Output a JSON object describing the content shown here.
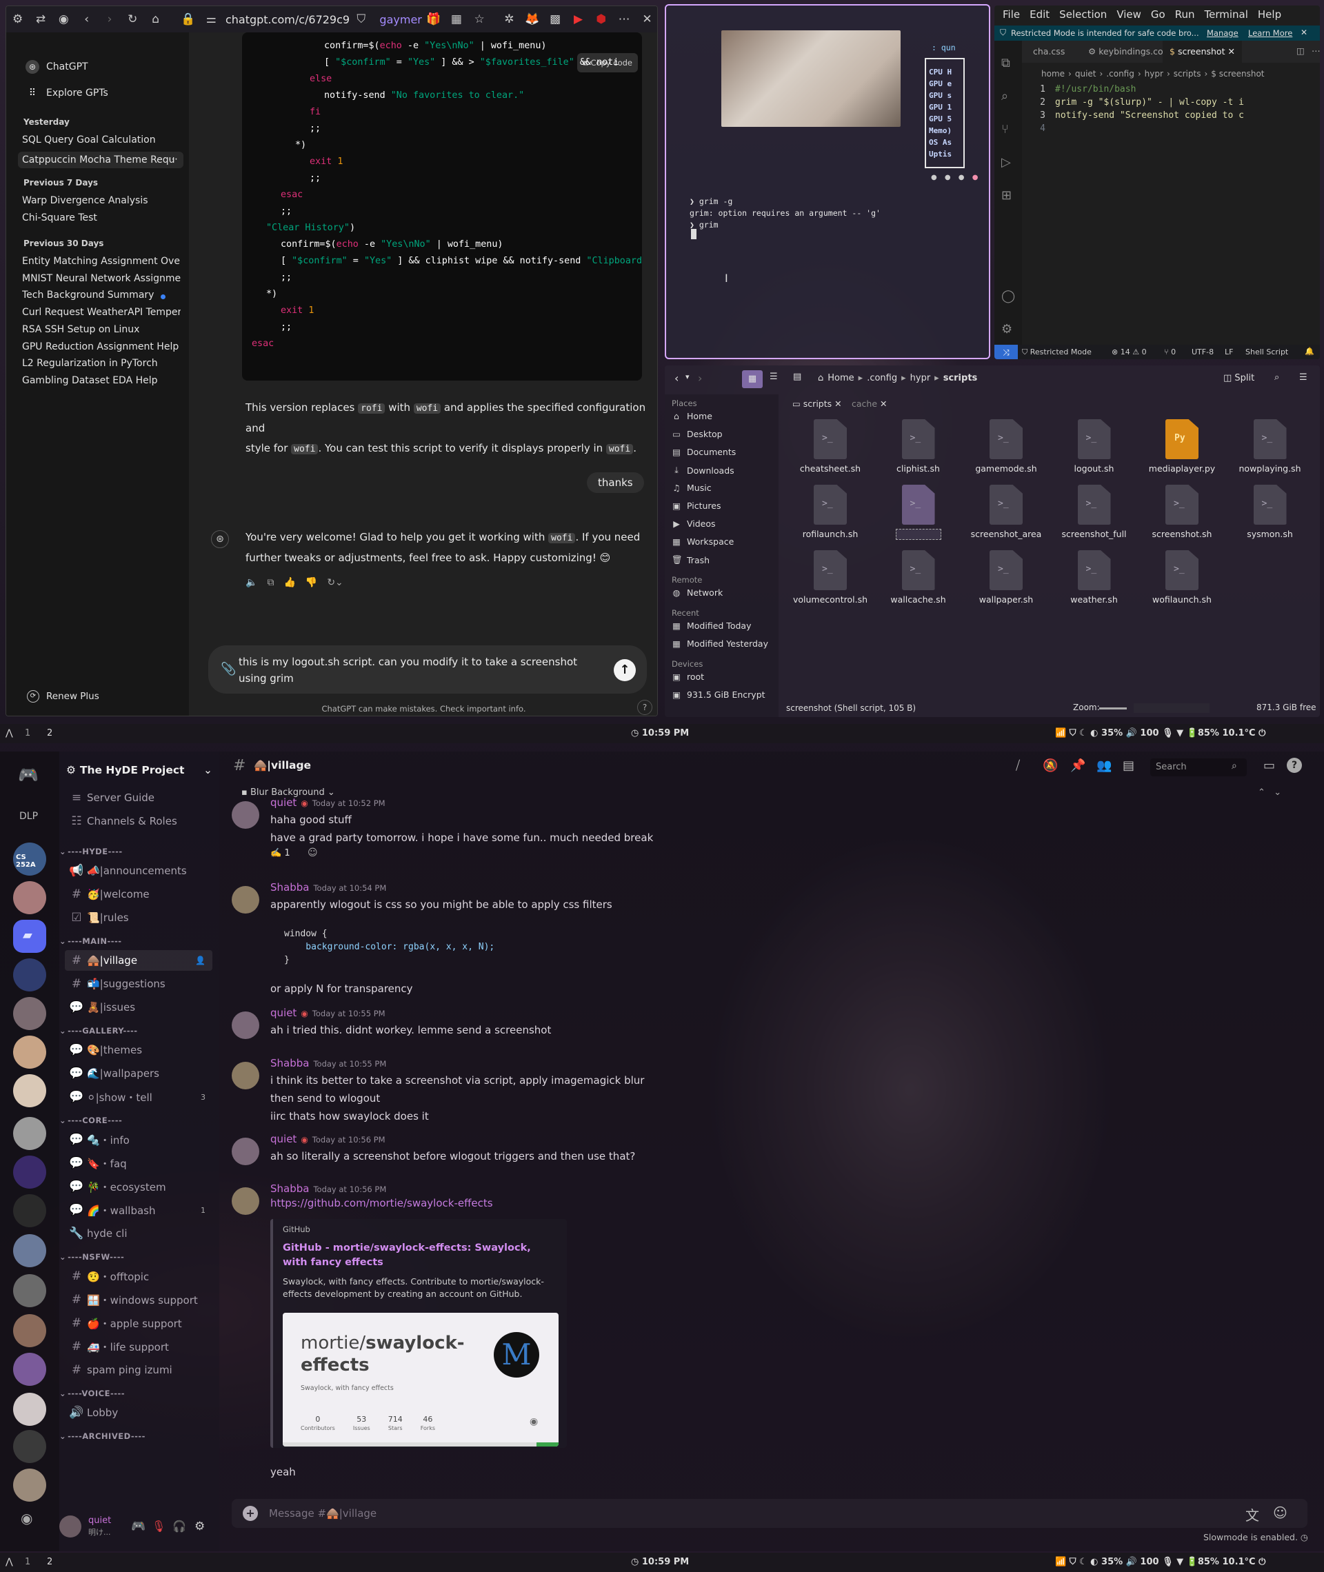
{
  "browser": {
    "url": "chatgpt.com/c/6729c9",
    "profile": "gaymer",
    "sidebar": {
      "top_items": [
        "ChatGPT",
        "Explore GPTs"
      ],
      "sections": [
        {
          "title": "Yesterday",
          "items": [
            "SQL Query Goal Calculation",
            "Catppuccin Mocha Theme Requ"
          ]
        },
        {
          "title": "Previous 7 Days",
          "items": [
            "Warp Divergence Analysis",
            "Chi-Square Test"
          ]
        },
        {
          "title": "Previous 30 Days",
          "items": [
            "Entity Matching Assignment Overv",
            "MNIST Neural Network Assignmen",
            "Tech Background Summary",
            "Curl Request WeatherAPI Tempera",
            "RSA SSH Setup on Linux",
            "GPU Reduction Assignment Help",
            "L2 Regularization in PyTorch",
            "Gambling Dataset EDA Help"
          ]
        }
      ],
      "renew": "Renew Plus"
    },
    "chat": {
      "copy_code": "Copy code",
      "code_lines": [
        {
          "indent": 10,
          "parts": [
            [
              "pl",
              "confirm=$("
            ],
            [
              "kw",
              "echo"
            ],
            [
              "pl",
              " -e "
            ],
            [
              "st",
              "\"Yes\\nNo\""
            ],
            [
              "pl",
              " | wofi_menu)"
            ]
          ]
        },
        {
          "indent": 10,
          "parts": [
            [
              "pl",
              "[ "
            ],
            [
              "st",
              "\"$confirm\""
            ],
            [
              "pl",
              " = "
            ],
            [
              "st",
              "\"Yes\""
            ],
            [
              "pl",
              " ] && > "
            ],
            [
              "st",
              "\"$favorites_file\""
            ],
            [
              "pl",
              " && noti"
            ]
          ]
        },
        {
          "indent": 8,
          "parts": [
            [
              "kw",
              "else"
            ]
          ]
        },
        {
          "indent": 10,
          "parts": [
            [
              "pl",
              "notify-send "
            ],
            [
              "st",
              "\"No favorites to clear.\""
            ]
          ]
        },
        {
          "indent": 8,
          "parts": [
            [
              "kw",
              "fi"
            ]
          ]
        },
        {
          "indent": 8,
          "parts": [
            [
              "pl",
              ";;"
            ]
          ]
        },
        {
          "indent": 6,
          "parts": [
            [
              "pl",
              "*)"
            ]
          ]
        },
        {
          "indent": 8,
          "parts": [
            [
              "kw",
              "exit"
            ],
            [
              "pl",
              " "
            ],
            [
              "vr",
              "1"
            ]
          ]
        },
        {
          "indent": 8,
          "parts": [
            [
              "pl",
              ";;"
            ]
          ]
        },
        {
          "indent": 4,
          "parts": [
            [
              "kw",
              "esac"
            ]
          ]
        },
        {
          "indent": 4,
          "parts": [
            [
              "pl",
              ";;"
            ]
          ]
        },
        {
          "indent": 2,
          "parts": [
            [
              "st",
              "\"Clear History\""
            ],
            [
              "pl",
              ")"
            ]
          ]
        },
        {
          "indent": 4,
          "parts": [
            [
              "pl",
              "confirm=$("
            ],
            [
              "kw",
              "echo"
            ],
            [
              "pl",
              " -e "
            ],
            [
              "st",
              "\"Yes\\nNo\""
            ],
            [
              "pl",
              " | wofi_menu)"
            ]
          ]
        },
        {
          "indent": 4,
          "parts": [
            [
              "pl",
              "[ "
            ],
            [
              "st",
              "\"$confirm\""
            ],
            [
              "pl",
              " = "
            ],
            [
              "st",
              "\"Yes\""
            ],
            [
              "pl",
              " ] && cliphist wipe && notify-send "
            ],
            [
              "st",
              "\"Clipboard"
            ]
          ]
        },
        {
          "indent": 4,
          "parts": [
            [
              "pl",
              ";;"
            ]
          ]
        },
        {
          "indent": 2,
          "parts": [
            [
              "pl",
              "*)"
            ]
          ]
        },
        {
          "indent": 4,
          "parts": [
            [
              "kw",
              "exit"
            ],
            [
              "pl",
              " "
            ],
            [
              "vr",
              "1"
            ]
          ]
        },
        {
          "indent": 4,
          "parts": [
            [
              "pl",
              ";;"
            ]
          ]
        },
        {
          "indent": 0,
          "parts": [
            [
              "kw",
              "esac"
            ]
          ]
        }
      ],
      "reply1_a": "This version replaces ",
      "reply1_rofi": "rofi",
      "reply1_b": " with ",
      "reply1_wofi": "wofi",
      "reply1_c": " and applies the specified configuration and",
      "reply1_d": "style for ",
      "reply1_e": ". You can test this script to verify it displays properly in ",
      "reply1_f": ".",
      "user_msg": "thanks",
      "reply2_a": "You're very welcome! Glad to help you get it working with ",
      "reply2_b": ". If you need",
      "reply2_c": "further tweaks or adjustments, feel free to ask. Happy customizing! 😊",
      "input_text": "this is my logout.sh script. can you modify it to take a screenshot using grim",
      "disclaimer": "ChatGPT can make mistakes. Check important info."
    }
  },
  "terminal": {
    "user": ": qun",
    "stats": [
      "CPU H",
      "GPU e",
      "GPU s",
      "GPU 1",
      "GPU 5",
      "Memo)",
      "OS As",
      "Uptis"
    ],
    "lines": [
      "❯ grim -g",
      "grim: option requires an argument -- 'g'",
      "❯ grim"
    ]
  },
  "vscode": {
    "menu": [
      "File",
      "Edit",
      "Selection",
      "View",
      "Go",
      "Run",
      "Terminal",
      "Help"
    ],
    "banner": "Restricted Mode is intended for safe code bro...",
    "banner_manage": "Manage",
    "banner_learn": "Learn More",
    "tabs": [
      "cha.css",
      "keybindings.conf",
      "screenshot"
    ],
    "breadcrumb": [
      "home",
      "quiet",
      ".config",
      "hypr",
      "scripts",
      "$ screenshot"
    ],
    "lines": [
      {
        "n": "1",
        "text": "#!/usr/bin/bash"
      },
      {
        "n": "2",
        "text": "grim -g \"$(slurp)\" - | wl-copy -t i"
      },
      {
        "n": "3",
        "text": "notify-send \"Screenshot copied to c"
      },
      {
        "n": "4",
        "text": ""
      }
    ],
    "status": {
      "mode": "Restricted Mode",
      "errors": "14",
      "warnings": "0",
      "ports": "0",
      "encoding": "UTF-8",
      "eol": "LF",
      "lang": "Shell Script"
    }
  },
  "files": {
    "path": [
      "Home",
      ".config",
      "hypr",
      "scripts"
    ],
    "split": "Split",
    "tabs": [
      "scripts",
      "cache"
    ],
    "places_title": "Places",
    "places": [
      "Home",
      "Desktop",
      "Documents",
      "Downloads",
      "Music",
      "Pictures",
      "Videos",
      "Workspace",
      "Trash"
    ],
    "remote_title": "Remote",
    "remote": [
      "Network"
    ],
    "recent_title": "Recent",
    "recent": [
      "Modified Today",
      "Modified Yesterday"
    ],
    "devices_title": "Devices",
    "devices": [
      "root",
      "931.5 GiB Encrypt"
    ],
    "items": [
      {
        "name": "cheatsheet.sh",
        "type": "sh"
      },
      {
        "name": "cliphist.sh",
        "type": "sh"
      },
      {
        "name": "gamemode.sh",
        "type": "sh"
      },
      {
        "name": "logout.sh",
        "type": "sh"
      },
      {
        "name": "mediaplayer.py",
        "type": "py"
      },
      {
        "name": "nowplaying.sh",
        "type": "sh"
      },
      {
        "name": "rofilaunch.sh",
        "type": "sh"
      },
      {
        "name": "",
        "type": "sel"
      },
      {
        "name": "screenshot_area",
        "type": "sh"
      },
      {
        "name": "screenshot_full",
        "type": "sh"
      },
      {
        "name": "screenshot.sh",
        "type": "sh"
      },
      {
        "name": "sysmon.sh",
        "type": "sh"
      },
      {
        "name": "volumecontrol.sh",
        "type": "sh"
      },
      {
        "name": "wallcache.sh",
        "type": "sh"
      },
      {
        "name": "wallpaper.sh",
        "type": "sh"
      },
      {
        "name": "weather.sh",
        "type": "sh"
      },
      {
        "name": "wofilaunch.sh",
        "type": "sh"
      }
    ],
    "status": "screenshot (Shell script, 105 B)",
    "zoom": "Zoom:",
    "free": "871.3 GiB free"
  },
  "topbar": {
    "ws1": "1",
    "ws2": "2",
    "time": "10:59 PM",
    "brightness": "35%",
    "volume": "100",
    "battery": "85%",
    "temp": "10.1°C"
  },
  "discord": {
    "server": "The HyDE Project",
    "dlp": "DLP",
    "guild_label": "CS 252A",
    "channel_header": "🛖|village",
    "blur": "Blur Background",
    "search": "Search",
    "nav": [
      {
        "icon": "≡",
        "label": "Server Guide"
      },
      {
        "icon": "☷",
        "label": "Channels & Roles"
      }
    ],
    "categories": [
      {
        "name": "----HYDE----",
        "channels": [
          {
            "icon": "📢",
            "label": "📣|announcements"
          },
          {
            "icon": "#",
            "label": "🥳|welcome"
          },
          {
            "icon": "☑",
            "label": "📜|rules"
          }
        ]
      },
      {
        "name": "----MAIN----",
        "channels": [
          {
            "icon": "#",
            "label": "🛖|village",
            "active": true
          },
          {
            "icon": "#",
            "label": "📬|suggestions"
          },
          {
            "icon": "💬",
            "label": "🧸|issues"
          }
        ]
      },
      {
        "name": "----GALLERY----",
        "channels": [
          {
            "icon": "💬",
            "label": "🎨|themes"
          },
          {
            "icon": "💬",
            "label": "🌊|wallpapers"
          },
          {
            "icon": "💬",
            "label": "⚪|show・tell",
            "badge": "3"
          }
        ]
      },
      {
        "name": "----CORE----",
        "channels": [
          {
            "icon": "💬",
            "label": "🔩・info"
          },
          {
            "icon": "💬",
            "label": "🔖・faq"
          },
          {
            "icon": "💬",
            "label": "🎋・ecosystem"
          },
          {
            "icon": "💬",
            "label": "🌈・wallbash",
            "badge": "1"
          },
          {
            "icon": "🔧",
            "label": "hyde cli"
          }
        ]
      },
      {
        "name": "----NSFW----",
        "channels": [
          {
            "icon": "#",
            "label": "🤨・offtopic"
          },
          {
            "icon": "#",
            "label": "🪟・windows support"
          },
          {
            "icon": "#",
            "label": "🍎・apple support"
          },
          {
            "icon": "#",
            "label": "🚑・life support"
          },
          {
            "icon": "#",
            "label": "spam ping izumi"
          }
        ]
      },
      {
        "name": "----VOICE----",
        "channels": [
          {
            "icon": "🔊",
            "label": "Lobby"
          }
        ]
      },
      {
        "name": "----ARCHIVED----",
        "channels": []
      }
    ],
    "messages": [
      {
        "author": "quiet",
        "color": "#c772d8",
        "time": "Today at 10:52 PM",
        "lines": [
          "haha good stuff",
          "have a grad party tomorrow. i hope i have some fun.. much needed break"
        ],
        "reaction": "✍️ 1"
      },
      {
        "author": "Shabba",
        "color": "#c772d8",
        "time": "Today at 10:54 PM",
        "lines": [
          "apparently wlogout is css so you might be able to apply css filters"
        ],
        "code": [
          "window {",
          "    background-color: rgba(x, x, x, N);",
          "}"
        ],
        "after": "or apply N for transparency"
      },
      {
        "author": "quiet",
        "color": "#c772d8",
        "time": "Today at 10:55 PM",
        "lines": [
          "ah i tried this. didnt workey. lemme send a screenshot"
        ]
      },
      {
        "author": "Shabba",
        "color": "#c772d8",
        "time": "Today at 10:55 PM",
        "lines": [
          "i think its better to take a screenshot via script, apply imagemagick blur",
          "then send to wlogout",
          "iirc thats how swaylock does it"
        ]
      },
      {
        "author": "quiet",
        "color": "#c772d8",
        "time": "Today at 10:56 PM",
        "lines": [
          "ah so literally a screenshot before wlogout triggers and then use that?"
        ]
      },
      {
        "author": "Shabba",
        "color": "#c772d8",
        "time": "Today at 10:56 PM",
        "link": "https://github.com/mortie/swaylock-effects"
      }
    ],
    "embed": {
      "provider": "GitHub",
      "title": "GitHub - mortie/swaylock-effects: Swaylock, with fancy effects",
      "desc": "Swaylock, with fancy effects. Contribute to mortie/swaylock-effects development by creating an account on GitHub.",
      "card_owner": "mortie/",
      "card_repo": "swaylock-effects",
      "card_sub": "Swaylock, with fancy effects",
      "stats": [
        {
          "n": "0",
          "l": "Contributors"
        },
        {
          "n": "53",
          "l": "Issues"
        },
        {
          "n": "714",
          "l": "Stars"
        },
        {
          "n": "46",
          "l": "Forks"
        }
      ]
    },
    "last_msg": "yeah",
    "composer_placeholder": "Message #🛖|village",
    "slowmode": "Slowmode is enabled.",
    "user": {
      "name": "quiet",
      "status": "明け..."
    }
  }
}
